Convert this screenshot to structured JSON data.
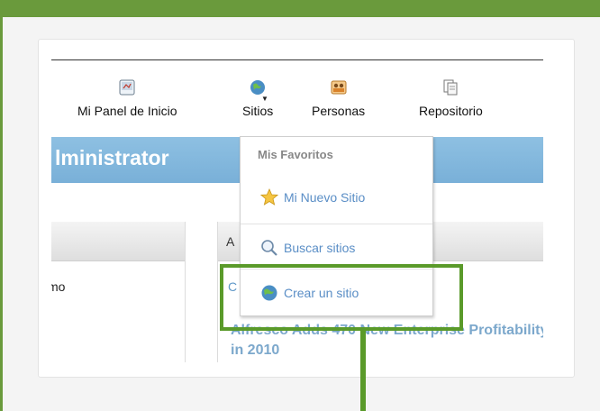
{
  "nav": {
    "items": [
      {
        "label": "Mi Panel de Inicio",
        "icon": "dashboard-icon"
      },
      {
        "label": "Sitios",
        "icon": "globe-icon"
      },
      {
        "label": "Personas",
        "icon": "people-icon"
      },
      {
        "label": "Repositorio",
        "icon": "repository-icon"
      }
    ]
  },
  "header": {
    "title": "lministrator"
  },
  "dashlets": {
    "left_text": "mo",
    "right_label": "A",
    "right_c": "C",
    "news_title": "Alfresco Adds 470 New Enterprise Profitability in 2010"
  },
  "dropdown": {
    "favorites_header": "Mis Favoritos",
    "favorite_site": "Mi Nuevo Sitio",
    "search_sites": "Buscar sitios",
    "create_site": "Crear un sitio"
  },
  "colors": {
    "accent_green": "#5a9a2a",
    "link_blue": "#5a8ec6",
    "band_blue": "#7ab3dc"
  }
}
